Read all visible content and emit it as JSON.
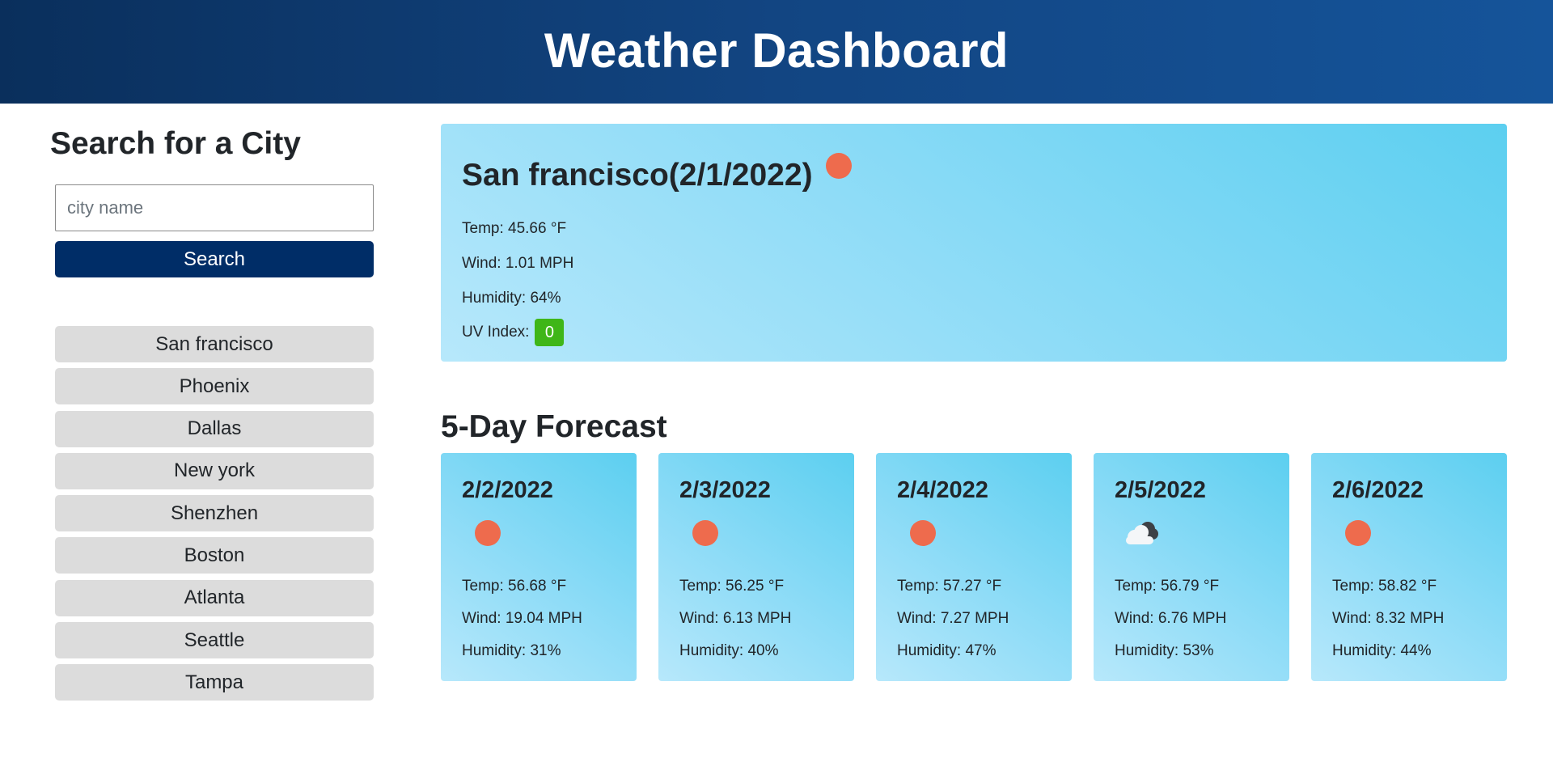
{
  "header": {
    "title": "Weather Dashboard"
  },
  "sidebar": {
    "heading": "Search for a City",
    "search_placeholder": "city name",
    "search_value": "",
    "search_button": "Search",
    "history": [
      "San francisco",
      "Phoenix",
      "Dallas",
      "New york",
      "Shenzhen",
      "Boston",
      "Atlanta",
      "Seattle",
      "Tampa"
    ]
  },
  "current": {
    "title": "San francisco(2/1/2022)",
    "icon": "sun-icon",
    "temp": "Temp: 45.66 °F",
    "wind": "Wind: 1.01 MPH",
    "humidity": "Humidity: 64%",
    "uv_label": "UV Index:",
    "uv_value": "0",
    "uv_color": "#3fb618"
  },
  "forecast": {
    "title": "5-Day Forecast",
    "days": [
      {
        "date": "2/2/2022",
        "icon": "sun-icon",
        "temp": "Temp: 56.68 °F",
        "wind": "Wind: 19.04 MPH",
        "humidity": "Humidity: 31%"
      },
      {
        "date": "2/3/2022",
        "icon": "sun-icon",
        "temp": "Temp: 56.25 °F",
        "wind": "Wind: 6.13 MPH",
        "humidity": "Humidity: 40%"
      },
      {
        "date": "2/4/2022",
        "icon": "sun-icon",
        "temp": "Temp: 57.27 °F",
        "wind": "Wind: 7.27 MPH",
        "humidity": "Humidity: 47%"
      },
      {
        "date": "2/5/2022",
        "icon": "cloud-icon",
        "temp": "Temp: 56.79 °F",
        "wind": "Wind: 6.76 MPH",
        "humidity": "Humidity: 53%"
      },
      {
        "date": "2/6/2022",
        "icon": "sun-icon",
        "temp": "Temp: 58.82 °F",
        "wind": "Wind: 8.32 MPH",
        "humidity": "Humidity: 44%"
      }
    ]
  },
  "colors": {
    "header_start": "#0a2f5c",
    "header_end": "#15549a",
    "search_button": "#002d67",
    "history_button": "#dcdcdc",
    "card_light": "#b7e8fb",
    "card_dark": "#5ccff0",
    "sun": "#ee6b4d"
  }
}
